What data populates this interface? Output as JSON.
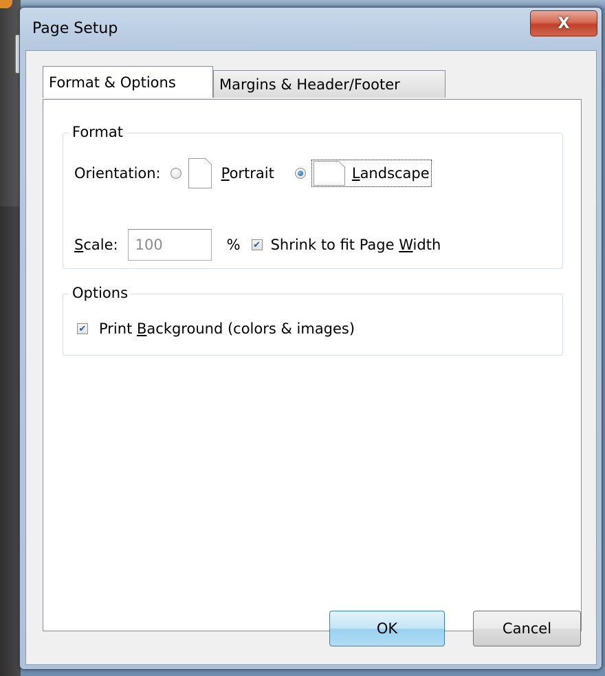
{
  "window": {
    "title": "Page Setup",
    "close_glyph": "X"
  },
  "tabs": [
    {
      "label": "Format & Options",
      "active": true
    },
    {
      "label": "Margins & Header/Footer",
      "active": false
    }
  ],
  "format": {
    "legend": "Format",
    "orientation_label": "Orientation:",
    "portrait": {
      "mnemonic": "P",
      "rest": "ortrait",
      "selected": false
    },
    "landscape": {
      "mnemonic": "L",
      "rest": "andscape",
      "selected": true
    },
    "scale": {
      "mnemonic": "S",
      "rest": "cale:",
      "value": "100",
      "unit": "%"
    },
    "shrink": {
      "before": "Shrink to fit Page ",
      "mnemonic": "W",
      "after": "idth",
      "checked": true
    }
  },
  "options": {
    "legend": "Options",
    "print_background": {
      "before": "Print ",
      "mnemonic": "B",
      "after": "ackground (colors & images)",
      "checked": true
    }
  },
  "buttons": {
    "ok": "OK",
    "cancel": "Cancel"
  },
  "icons": {
    "check_glyph": "✔"
  },
  "colors": {
    "close_red": "#c2412a",
    "ok_blue": "#98d1ef",
    "radio_blue": "#1a5a99"
  }
}
